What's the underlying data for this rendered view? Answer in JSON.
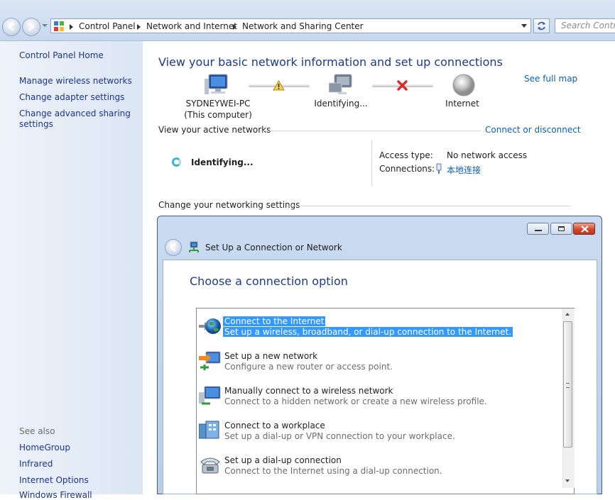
{
  "breadcrumb": {
    "items": [
      "Control Panel",
      "Network and Internet",
      "Network and Sharing Center"
    ],
    "search_placeholder": "Search Control Panel"
  },
  "sidebar": {
    "home": "Control Panel Home",
    "links": [
      "Manage wireless networks",
      "Change adapter settings",
      "Change advanced sharing",
      "settings"
    ],
    "see_also_label": "See also",
    "see_also": [
      "HomeGroup",
      "Infrared",
      "Internet Options",
      "Windows Firewall"
    ]
  },
  "main": {
    "title": "View your basic network information and set up connections",
    "see_full_map": "See full map",
    "computer_name": "SYDNEYWEI-PC",
    "computer_sub": "(This computer)",
    "middle_node": "Identifying...",
    "internet_node": "Internet",
    "active_networks": "View your active networks",
    "connect_disconnect": "Connect or disconnect",
    "identifying": "Identifying...",
    "access_type_label": "Access type:",
    "access_type_value": "No network access",
    "connections_label": "Connections:",
    "connections_value": "本地连接",
    "change_settings": "Change your networking settings"
  },
  "dialog": {
    "title": "Set Up a Connection or Network",
    "heading": "Choose a connection option",
    "options": [
      {
        "title": "Connect to the Internet",
        "desc": "Set up a wireless, broadband, or dial-up connection to the Internet.",
        "icon": "globe-icon"
      },
      {
        "title": "Set up a new network",
        "desc": "Configure a new router or access point.",
        "icon": "new-network-icon"
      },
      {
        "title": "Manually connect to a wireless network",
        "desc": "Connect to a hidden network or create a new wireless profile.",
        "icon": "wireless-network-icon"
      },
      {
        "title": "Connect to a workplace",
        "desc": "Set up a dial-up or VPN connection to your workplace.",
        "icon": "workplace-icon"
      },
      {
        "title": "Set up a dial-up connection",
        "desc": "Connect to the Internet using a dial-up connection.",
        "icon": "dialup-phone-icon"
      }
    ]
  },
  "colors": {
    "link": "#1e3287",
    "heading": "#1e3a8a",
    "selection": "#3399ff"
  }
}
